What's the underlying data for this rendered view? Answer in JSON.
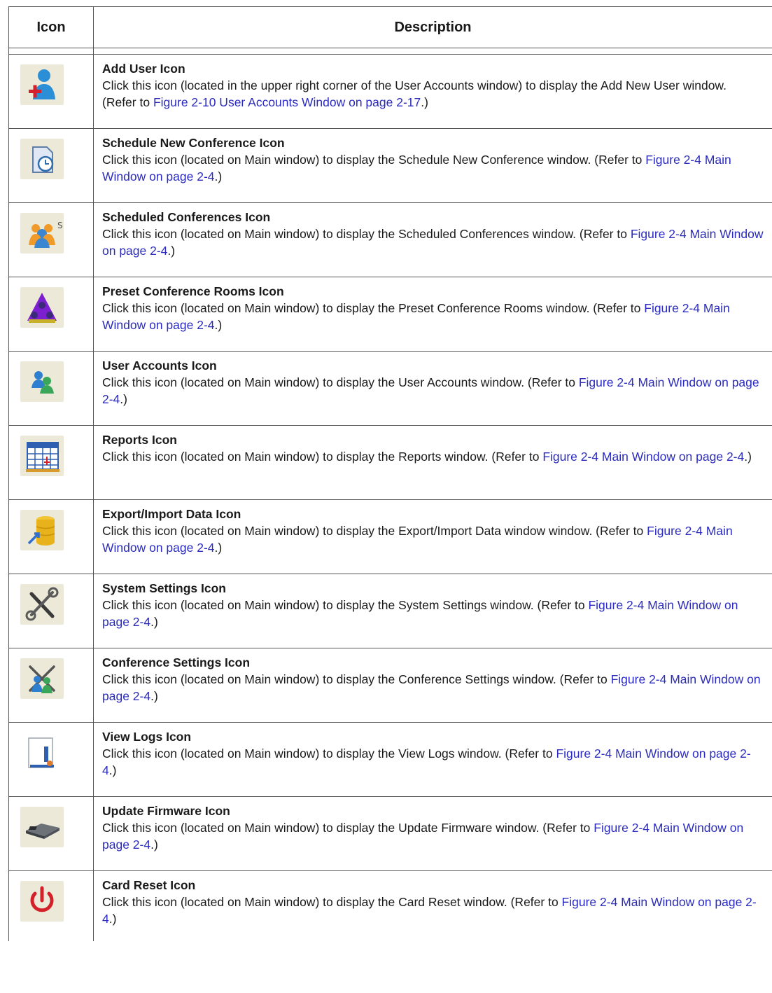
{
  "header": {
    "icon": "Icon",
    "description": "Description"
  },
  "rows": [
    {
      "icon": "add-user-icon",
      "title": "Add User Icon",
      "pre": "Click this icon (located in the upper right corner of the User Accounts window) to display the Add New User window.  (Refer to ",
      "link": "Figure 2-10 User Accounts Window on page 2-17",
      "post": ".)"
    },
    {
      "icon": "schedule-new-conference-icon",
      "title": "Schedule New Conference Icon",
      "pre": "Click this icon (located on Main window) to display the Schedule New Conference window.   (Refer to ",
      "link": "Figure 2-4 Main Window on page 2-4",
      "post": ".)"
    },
    {
      "icon": "scheduled-conferences-icon",
      "title": "Scheduled Conferences Icon",
      "pre": "Click this icon (located on Main window) to display the Scheduled Conferences window. (Refer to ",
      "link": "Figure 2-4 Main Window on page 2-4",
      "post": ".)"
    },
    {
      "icon": "preset-conference-rooms-icon",
      "title": "Preset Conference Rooms Icon",
      "pre": "Click this icon (located on Main window) to display the Preset Conference Rooms window. (Refer to ",
      "link": "Figure 2-4 Main Window on page 2-4",
      "post": ".)"
    },
    {
      "icon": "user-accounts-icon",
      "title": "User Accounts Icon",
      "pre": "Click this icon (located on Main window) to display the User Accounts window.  (Refer to ",
      "link": "Figure 2-4 Main Window on page 2-4",
      "post": ".)"
    },
    {
      "icon": "reports-icon",
      "title": "Reports Icon",
      "pre": "Click this icon (located on Main window) to display the Reports window.  (Refer to ",
      "link": "Figure 2-4 Main Window on page 2-4",
      "post": ".)"
    },
    {
      "icon": "export-import-data-icon",
      "title": "Export/Import Data Icon",
      "pre": "Click this icon (located on Main window) to display the Export/Import Data window window.  (Refer to ",
      "link": "Figure 2-4 Main Window on page 2-4",
      "post": ".)"
    },
    {
      "icon": "system-settings-icon",
      "title": "System Settings Icon",
      "pre": "Click this icon (located on Main window) to display the System Settings window.  (Refer to ",
      "link": "Figure 2-4 Main Window on page 2-4",
      "post": ".)"
    },
    {
      "icon": "conference-settings-icon",
      "title": "Conference Settings Icon",
      "pre": "Click this icon (located on Main window) to display the Conference Settings window. (Refer to ",
      "link": "Figure 2-4 Main Window on page 2-4",
      "post": ".)"
    },
    {
      "icon": "view-logs-icon",
      "title": "View Logs Icon",
      "pre": "Click this icon (located on Main window) to display the View Logs window.  (Refer to ",
      "link": "Figure 2-4 Main Window on page 2-4",
      "post": ".)"
    },
    {
      "icon": "update-firmware-icon",
      "title": "Update Firmware Icon",
      "pre": "Click this icon (located on Main window) to display the Update Firmware window.  (Refer to ",
      "link": "Figure 2-4 Main Window on page 2-4",
      "post": ".)"
    },
    {
      "icon": "card-reset-icon",
      "title": "Card Reset Icon",
      "pre": "Click this icon (located on Main window) to display the Card Reset window.  (Refer to ",
      "link": "Figure 2-4 Main Window on page 2-4",
      "post": ".)"
    }
  ]
}
